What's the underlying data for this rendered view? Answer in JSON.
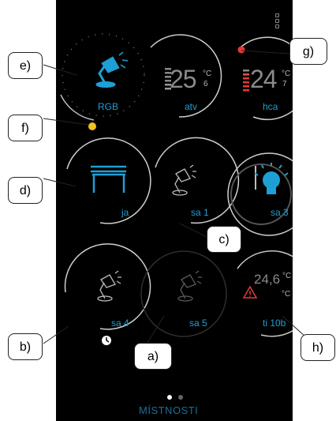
{
  "tiles": [
    {
      "label": "RGB"
    },
    {
      "label": "atv",
      "temp": "25",
      "unit": "°C",
      "frac": "6"
    },
    {
      "label": "hca",
      "temp": "24",
      "unit": "°C",
      "frac": "7"
    },
    {
      "label": "ja"
    },
    {
      "label": "sa 1"
    },
    {
      "label": "sa 3"
    },
    {
      "label": "sa 4"
    },
    {
      "label": "sa 5"
    },
    {
      "label": "ti 10b",
      "temp": "24,6",
      "unit": "°C",
      "unit2": "°C"
    }
  ],
  "footer": {
    "label": "MÍSTNOSTI",
    "pages": 2,
    "active_page": 1
  },
  "callouts": [
    "e)",
    "f)",
    "g)",
    "d)",
    "c)",
    "b)",
    "a)",
    "h)"
  ],
  "colors": {
    "accent": "#1e9fd6",
    "background": "#000000",
    "ring": "#bdbdbd",
    "alarm": "#e53935",
    "knob": "#f2c21b"
  }
}
